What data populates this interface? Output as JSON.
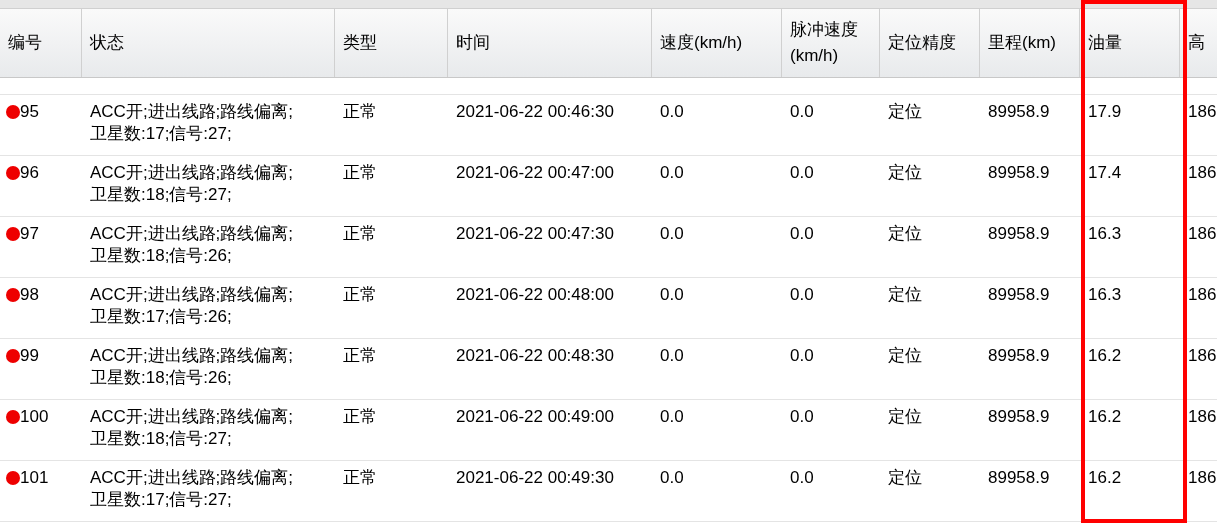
{
  "table": {
    "columns": [
      {
        "label": "编号",
        "highlighted": false
      },
      {
        "label": "状态",
        "highlighted": false
      },
      {
        "label": "类型",
        "highlighted": false
      },
      {
        "label": "时间",
        "highlighted": false
      },
      {
        "label": "速度(km/h)",
        "highlighted": false
      },
      {
        "label": "脉冲速度(km/h)",
        "highlighted": false
      },
      {
        "label": "定位精度",
        "highlighted": false
      },
      {
        "label": "里程(km)",
        "highlighted": false
      },
      {
        "label": "油量",
        "highlighted": true
      },
      {
        "label": "高",
        "highlighted": false
      }
    ],
    "rows": [
      {
        "color": "#ee0000",
        "cells": [
          "95",
          "ACC开;进出线路;路线偏离;卫星数:17;信号:27;",
          "正常",
          "2021-06-22 00:46:30",
          "0.0",
          "0.0",
          "定位",
          "89958.9",
          "17.9",
          "186"
        ]
      },
      {
        "color": "#ee0000",
        "cells": [
          "96",
          "ACC开;进出线路;路线偏离;卫星数:18;信号:27;",
          "正常",
          "2021-06-22 00:47:00",
          "0.0",
          "0.0",
          "定位",
          "89958.9",
          "17.4",
          "186"
        ]
      },
      {
        "color": "#ee0000",
        "cells": [
          "97",
          "ACC开;进出线路;路线偏离;卫星数:18;信号:26;",
          "正常",
          "2021-06-22 00:47:30",
          "0.0",
          "0.0",
          "定位",
          "89958.9",
          "16.3",
          "186"
        ]
      },
      {
        "color": "#ee0000",
        "cells": [
          "98",
          "ACC开;进出线路;路线偏离;卫星数:17;信号:26;",
          "正常",
          "2021-06-22 00:48:00",
          "0.0",
          "0.0",
          "定位",
          "89958.9",
          "16.3",
          "186"
        ]
      },
      {
        "color": "#ee0000",
        "cells": [
          "99",
          "ACC开;进出线路;路线偏离;卫星数:18;信号:26;",
          "正常",
          "2021-06-22 00:48:30",
          "0.0",
          "0.0",
          "定位",
          "89958.9",
          "16.2",
          "186"
        ]
      },
      {
        "color": "#ee0000",
        "cells": [
          "100",
          "ACC开;进出线路;路线偏离;卫星数:18;信号:27;",
          "正常",
          "2021-06-22 00:49:00",
          "0.0",
          "0.0",
          "定位",
          "89958.9",
          "16.2",
          "186"
        ]
      },
      {
        "color": "#ee0000",
        "cells": [
          "101",
          "ACC开;进出线路;路线偏离;卫星数:17;信号:27;",
          "正常",
          "2021-06-22 00:49:30",
          "0.0",
          "0.0",
          "定位",
          "89958.9",
          "16.2",
          "186"
        ]
      }
    ]
  }
}
